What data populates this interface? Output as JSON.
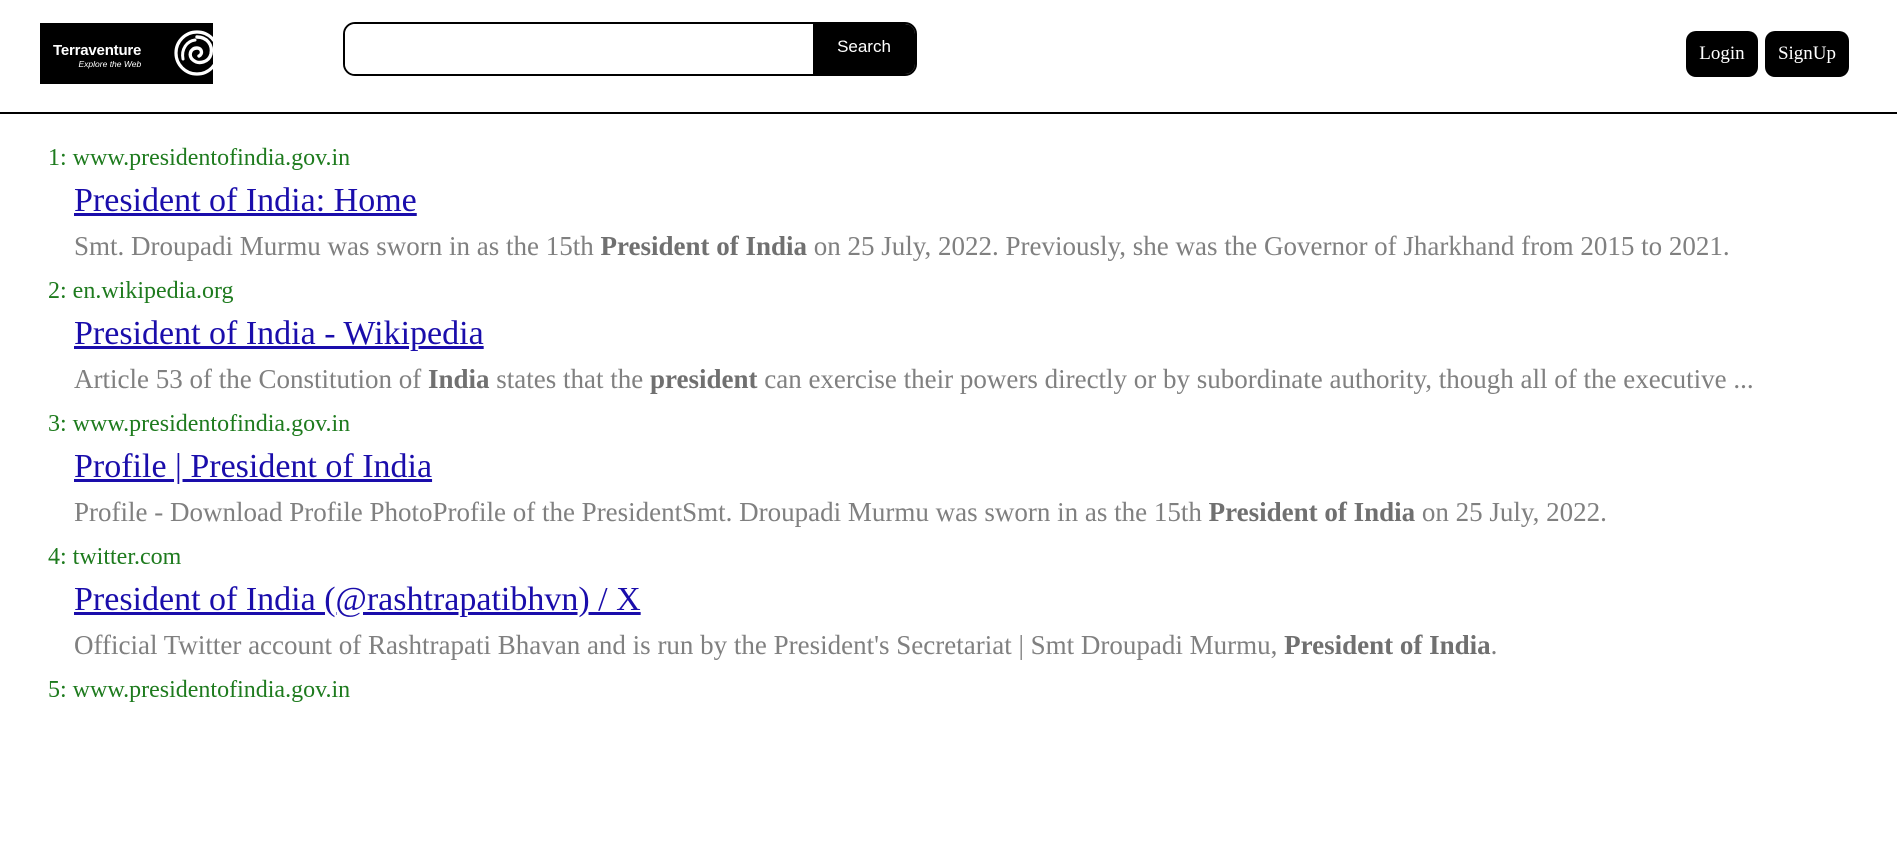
{
  "brand": {
    "name": "Terraventure",
    "tagline": "Explore the Web"
  },
  "search": {
    "value": "",
    "placeholder": "",
    "button_label": "Search"
  },
  "auth": {
    "login_label": "Login",
    "signup_label": "SignUp"
  },
  "colors": {
    "source": "#1e7b1e",
    "title_link": "#1a0dab",
    "snippet": "#808080",
    "header_border": "#000000"
  },
  "results": [
    {
      "index": "1:",
      "source": "www.presidentofindia.gov.in",
      "title": "President of India: Home",
      "snippet": [
        {
          "text": "Smt. Droupadi Murmu was sworn in as the 15th ",
          "bold": false
        },
        {
          "text": "President of India",
          "bold": true
        },
        {
          "text": " on 25 July, 2022. Previously, she was the Governor of Jharkhand from 2015 to 2021.",
          "bold": false
        }
      ]
    },
    {
      "index": "2:",
      "source": "en.wikipedia.org",
      "title": "President of India - Wikipedia",
      "snippet": [
        {
          "text": "Article 53 of the Constitution of ",
          "bold": false
        },
        {
          "text": "India",
          "bold": true
        },
        {
          "text": " states that the ",
          "bold": false
        },
        {
          "text": "president",
          "bold": true
        },
        {
          "text": " can exercise their powers directly or by subordinate authority, though all of the executive ...",
          "bold": false
        }
      ]
    },
    {
      "index": "3:",
      "source": "www.presidentofindia.gov.in",
      "title": "Profile | President of India",
      "snippet": [
        {
          "text": "Profile - Download Profile PhotoProfile of the PresidentSmt. Droupadi Murmu was sworn in as the 15th ",
          "bold": false
        },
        {
          "text": "President of India",
          "bold": true
        },
        {
          "text": " on 25 July, 2022.",
          "bold": false
        }
      ]
    },
    {
      "index": "4:",
      "source": "twitter.com",
      "title": "President of India (@rashtrapatibhvn) / X",
      "snippet": [
        {
          "text": "Official Twitter account of Rashtrapati Bhavan and is run by the President's Secretariat | Smt Droupadi Murmu, ",
          "bold": false
        },
        {
          "text": "President of India",
          "bold": true
        },
        {
          "text": ".",
          "bold": false
        }
      ]
    },
    {
      "index": "5:",
      "source": "www.presidentofindia.gov.in",
      "title": "",
      "snippet": []
    }
  ]
}
